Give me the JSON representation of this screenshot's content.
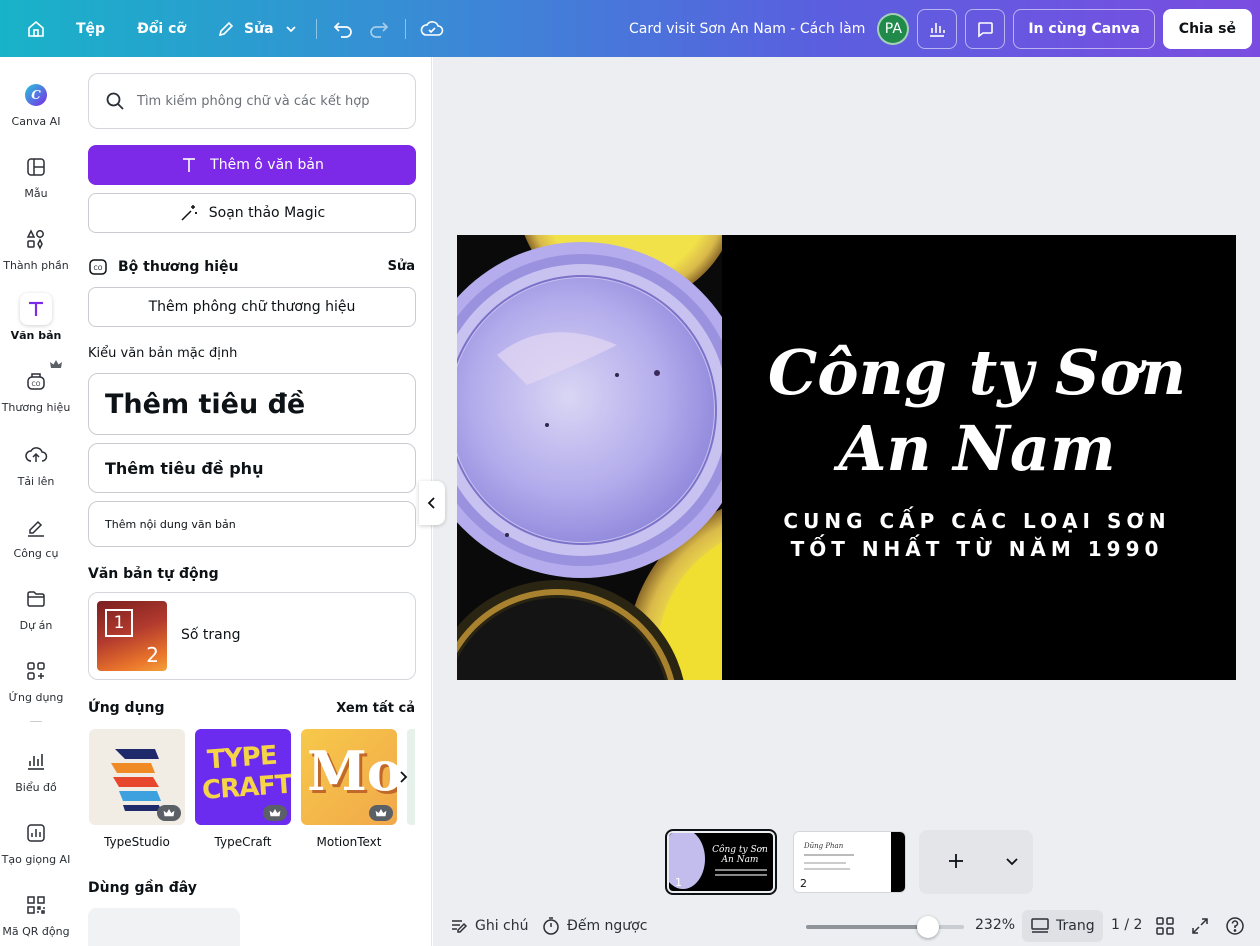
{
  "colors": {
    "accent": "#7d2ae8",
    "canvas_bg": "#000000"
  },
  "topbar": {
    "home_icon": "home-icon",
    "file": "Tệp",
    "resize": "Đổi cỡ",
    "edit": "Sửa",
    "doc_title": "Card visit Sơn An Nam - Cách làm",
    "avatar": "PA",
    "print": "In cùng Canva",
    "share": "Chia sẻ"
  },
  "rail": {
    "items": [
      {
        "label": "Canva AI",
        "icon": "canva-ai-icon"
      },
      {
        "label": "Mẫu",
        "icon": "template-icon"
      },
      {
        "label": "Thành phần",
        "icon": "elements-icon"
      },
      {
        "label": "Văn bản",
        "icon": "text-icon"
      },
      {
        "label": "Thương hiệu",
        "icon": "brand-icon"
      },
      {
        "label": "Tải lên",
        "icon": "upload-icon"
      },
      {
        "label": "Công cụ",
        "icon": "tools-icon"
      },
      {
        "label": "Dự án",
        "icon": "folder-icon"
      },
      {
        "label": "Ứng dụng",
        "icon": "apps-icon"
      },
      {
        "label": "Biểu đồ",
        "icon": "chart-icon"
      },
      {
        "label": "Tạo giọng AI",
        "icon": "ai-voice-icon"
      },
      {
        "label": "Mã QR động",
        "icon": "qr-icon"
      }
    ]
  },
  "panel": {
    "search_placeholder": "Tìm kiếm phông chữ và các kết hợp",
    "add_textbox": "Thêm ô văn bản",
    "magic_write": "Soạn thảo Magic",
    "brand_kit": "Bộ thương hiệu",
    "brand_edit": "Sửa",
    "add_brand_font": "Thêm phông chữ thương hiệu",
    "default_styles": "Kiểu văn bản mặc định",
    "heading": "Thêm tiêu đề",
    "subheading": "Thêm tiêu đề phụ",
    "body": "Thêm nội dung văn bản",
    "auto_text": "Văn bản tự động",
    "page_number": "Số trang",
    "page_number_icon_a": "1",
    "page_number_icon_b": "2",
    "apps": "Ứng dụng",
    "see_all": "Xem tất cả",
    "app_list": [
      {
        "name": "TypeStudio",
        "tile_text": ""
      },
      {
        "name": "TypeCraft",
        "tile_text": "TYPE CRAFT"
      },
      {
        "name": "MotionText",
        "tile_text": "Mo"
      }
    ],
    "recent": "Dùng gần đây"
  },
  "canvas": {
    "title": "Công ty Sơn An Nam",
    "subtitle": "CUNG CẤP CÁC LOẠI SƠN TỐT NHẤT TỪ NĂM 1990"
  },
  "pages": {
    "thumb1_num": "1",
    "thumb1_title": "Công ty Sơn An Nam",
    "thumb2_num": "2",
    "thumb2_name": "Dũng Phan"
  },
  "footer": {
    "notes": "Ghi chú",
    "timer": "Đếm ngược",
    "zoom": "232%",
    "zoom_level": 0.77,
    "pages_label": "Trang",
    "page_count": "1 / 2"
  }
}
